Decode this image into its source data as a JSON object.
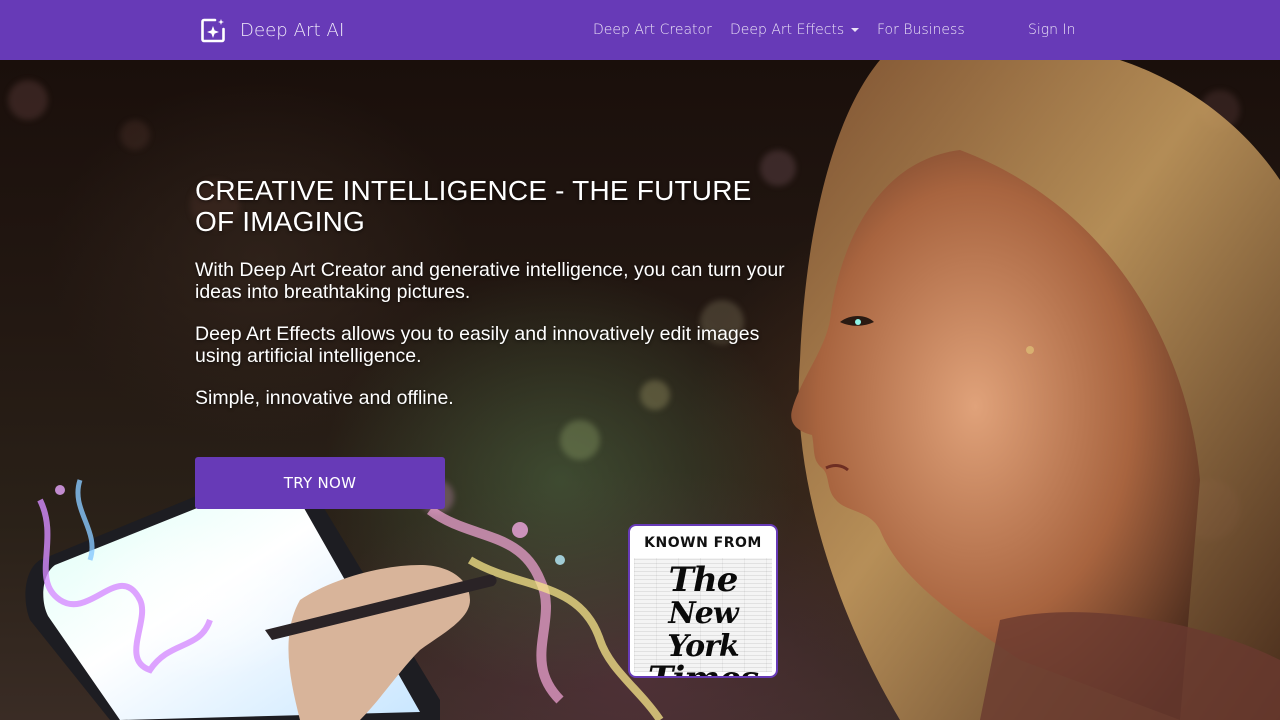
{
  "navbar": {
    "brand": "Deep Art AI",
    "links": {
      "creator": "Deep Art Creator",
      "effects": "Deep Art Effects",
      "business": "For Business",
      "signin": "Sign In"
    }
  },
  "hero": {
    "title": "CREATIVE INTELLIGENCE - THE FUTURE OF IMAGING",
    "paragraph1": "With Deep Art Creator and generative intelligence, you can turn your ideas into breathtaking pictures.",
    "paragraph2": "Deep Art Effects allows you to easily and innovatively edit images using artificial intelligence.",
    "paragraph3": "Simple, innovative and offline.",
    "cta": "TRY NOW"
  },
  "badge": {
    "heading": "KNOWN FROM",
    "logo_line1": "The",
    "logo_line2": "New York",
    "logo_line3": "Times"
  },
  "colors": {
    "accent": "#673ab7"
  }
}
